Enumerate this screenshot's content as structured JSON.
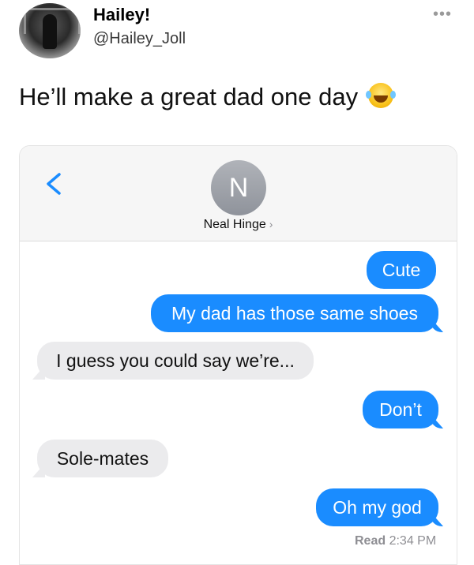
{
  "tweet": {
    "display_name": "Hailey!",
    "handle": "@Hailey_Joll",
    "more_icon": "more-horizontal-icon",
    "text": "He’ll make a great dad one day",
    "emoji": "face-with-tears-of-joy"
  },
  "conversation": {
    "back_icon": "chevron-left-icon",
    "contact_initial": "N",
    "contact_name": "Neal Hinge",
    "contact_chevron": "›",
    "messages": [
      {
        "side": "sent",
        "text": "Cute"
      },
      {
        "side": "sent",
        "text": "My dad has those same shoes"
      },
      {
        "side": "received",
        "text": "I guess you could say we’re..."
      },
      {
        "side": "sent",
        "text": "Don’t"
      },
      {
        "side": "received",
        "text": "Sole-mates"
      },
      {
        "side": "sent",
        "text": "Oh my god"
      }
    ],
    "read_label": "Read",
    "read_time": "2:34 PM"
  },
  "colors": {
    "sent_bubble": "#1a8cff",
    "received_bubble": "#ebebed",
    "ios_blue": "#1a8cff"
  }
}
